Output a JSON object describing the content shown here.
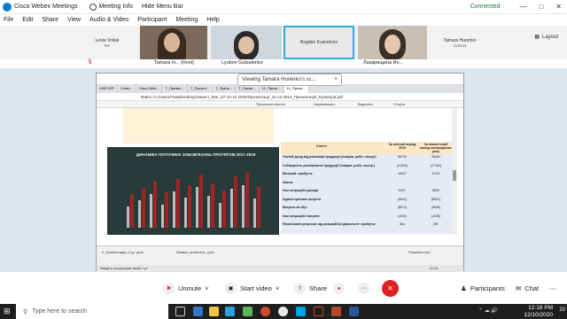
{
  "titlebar": {
    "app_title": "Cisco Webex Meetings",
    "meeting_info": "Meeting Info",
    "hide_menu_bar": "Hide Menu Bar",
    "connection": "Connected",
    "status_color": "#1e7f38"
  },
  "menu": [
    "File",
    "Edit",
    "Share",
    "View",
    "Audio & Video",
    "Participant",
    "Meeting",
    "Help"
  ],
  "participants_strip": {
    "tiles": [
      {
        "name": "Lesia Voliak",
        "sub": "Me"
      },
      {
        "name": "Bogdan Kuznetsov",
        "sub": ""
      },
      {
        "name": "Tamara Hurenko",
        "sub": "Cohost"
      }
    ],
    "name_labels": [
      "Tamara H... (Host)",
      "Lyubov Gutsalenko",
      "Лазарищина Ин..."
    ],
    "layout_label": "Layout"
  },
  "shared_screen": {
    "banner": "Viewing Tamara Hurenko's sc...",
    "tabs": [
      "LMS EST",
      "Співп...",
      "Cisco Web...",
      "Т_Презен...",
      "Т_Презен...",
      "7_Презе...",
      "T_Презе...",
      "11_Презе...",
      "11_Презе..."
    ],
    "address": "C:/Users/Тома/Desktop/Захист_Маг_07-10-12.2020/Презентації_10.12.2012_Презентація_Кузнецов.pdf",
    "address_label": "Файл",
    "pdf_tools": [
      "Прочитати вголос",
      "Намалювати",
      "Виділити",
      "Стерти"
    ],
    "slide_title": "ДИНАМІКА ПОТОЧНИХ ЗОБОВ'ЯЗАНЬ ПРОТЯГОМ 2017-2019",
    "table": {
      "header": [
        "Стаття",
        "За звітний період 2019",
        "За аналогічний період попереднього року"
      ],
      "rows": [
        [
          "Чистий дохід від реалізації продукції (товарів, робіт, послуг)",
          "56753",
          "38484"
        ],
        [
          "Собівартість реалізованої продукції (товарів, робіт, послуг)",
          "(41026)",
          "(47164)"
        ],
        [
          "Валовий: прибуток",
          "15027",
          "11322"
        ],
        [
          "збиток",
          "",
          ""
        ],
        [
          "Інші операційні доходи",
          "6297",
          "6893"
        ],
        [
          "Адміністративні витрати",
          "(9941)",
          "(8621)"
        ],
        [
          "Витрати на збут",
          "(8574)",
          "(9508)"
        ],
        [
          "Інші операційні витрати",
          "(1150)",
          "(1155)"
        ],
        [
          "Фінансовий результат від операційної діяльності: прибуток",
          "664",
          "287"
        ]
      ]
    },
    "taskbar_items": [
      "2_Презентація_Сту...pptx",
      "Заявка_презента...pptx"
    ],
    "show_all": "Показати все",
    "inner_time": "12:18",
    "inner_date": "10.12.2020",
    "inner_search": "Введіть пошуковий запит тут"
  },
  "controls": {
    "unmute": "Unmute",
    "start_video": "Start video",
    "share": "Share",
    "participants": "Participants",
    "chat": "Chat"
  },
  "taskbar": {
    "search_placeholder": "Type here to search",
    "time": "12:18 PM",
    "date": "12/10/2020",
    "notification_count": "20"
  }
}
